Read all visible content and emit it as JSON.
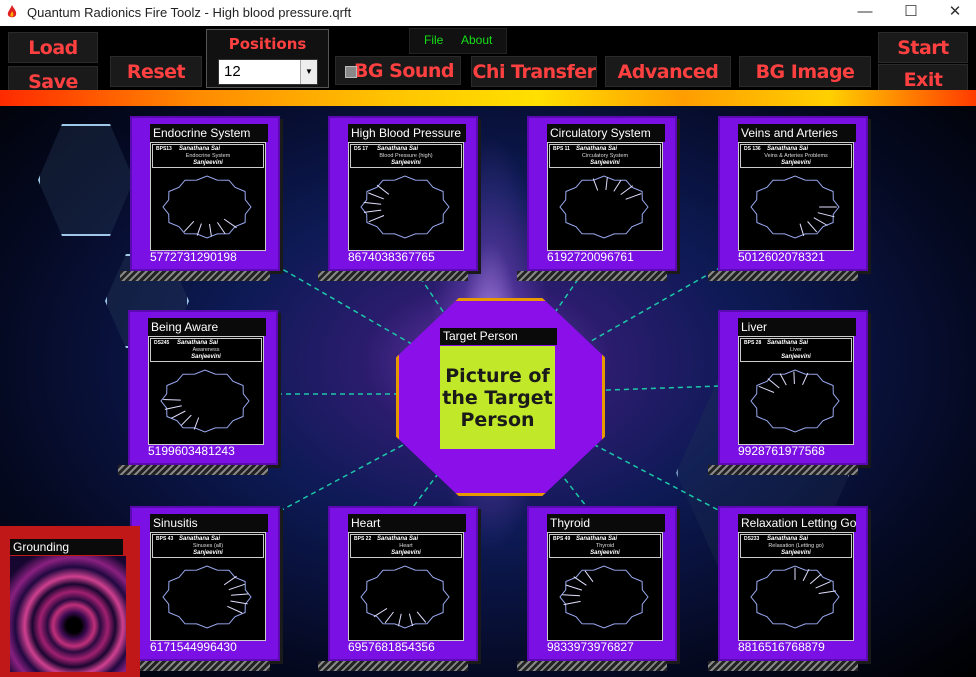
{
  "window": {
    "title": "Quantum Radionics Fire Toolz - High blood pressure.qrft",
    "minimize": "—",
    "maximize": "☐",
    "close": "✕"
  },
  "toolbar": {
    "load": "Load",
    "save": "Save",
    "reset": "Reset",
    "positions_label": "Positions",
    "positions_value": "12",
    "bg_sound": "BG Sound",
    "chi_transfer": "Chi Transfer",
    "advanced": "Advanced",
    "bg_image": "BG Image",
    "start": "Start",
    "exit": "Exit"
  },
  "menu": {
    "file": "File",
    "about": "About"
  },
  "target": {
    "label": "Target Person",
    "picture_text": "Picture of the Target Person"
  },
  "grounding": {
    "label": "Grounding"
  },
  "panels": [
    {
      "title": "Endocrine System",
      "code": "BPS13",
      "sai": "Sanathana Sai",
      "name": "Endocrine System",
      "sj": "Sanjeevini",
      "number": "5772731290198"
    },
    {
      "title": "High Blood Pressure",
      "code": "DS 17",
      "sai": "Sanathana Sai",
      "name": "Blood Pressure (high)",
      "sj": "Sanjeevini",
      "number": "8674038367765"
    },
    {
      "title": "Circulatory System",
      "code": "BPS 11",
      "sai": "Sanathana Sai",
      "name": "Circulatory System",
      "sj": "Sanjeevini",
      "number": "6192720096761"
    },
    {
      "title": "Veins and Arteries",
      "code": "DS 136",
      "sai": "Sanathana Sai",
      "name": "Veins & Arteries Problems",
      "sj": "Sanjeevini",
      "number": "5012602078321"
    },
    {
      "title": "Being Aware",
      "code": "DS245",
      "sai": "Sanathana Sai",
      "name": "Awareness",
      "sj": "Sanjeevini",
      "number": "5199603481243"
    },
    {
      "title": "Liver",
      "code": "BPS 28",
      "sai": "Sanathana Sai",
      "name": "Liver",
      "sj": "Sanjeevini",
      "number": "9928761977568"
    },
    {
      "title": "Sinusitis",
      "code": "BPS 43",
      "sai": "Sanathana Sai",
      "name": "Sinuses (all)",
      "sj": "Sanjeevini",
      "number": "6171544996430"
    },
    {
      "title": "Heart",
      "code": "BPS 22",
      "sai": "Sanathana Sai",
      "name": "Heart",
      "sj": "Sanjeevini",
      "number": "6957681854356"
    },
    {
      "title": "Thyroid",
      "code": "BPS 49",
      "sai": "Sanathana Sai",
      "name": "Thyroid",
      "sj": "Sanjeevini",
      "number": "9833973976827"
    },
    {
      "title": "Relaxation Letting Go",
      "code": "DS233",
      "sai": "Sanathana Sai",
      "name": "Relaxation (Letting go)",
      "sj": "Sanjeevini",
      "number": "8816516768879"
    }
  ],
  "colors": {
    "button_text": "#ff4040",
    "menu_text": "#16e016",
    "panel": "#7b10e4",
    "target_border": "#e69a00",
    "picture_bg": "#c2e82a"
  }
}
